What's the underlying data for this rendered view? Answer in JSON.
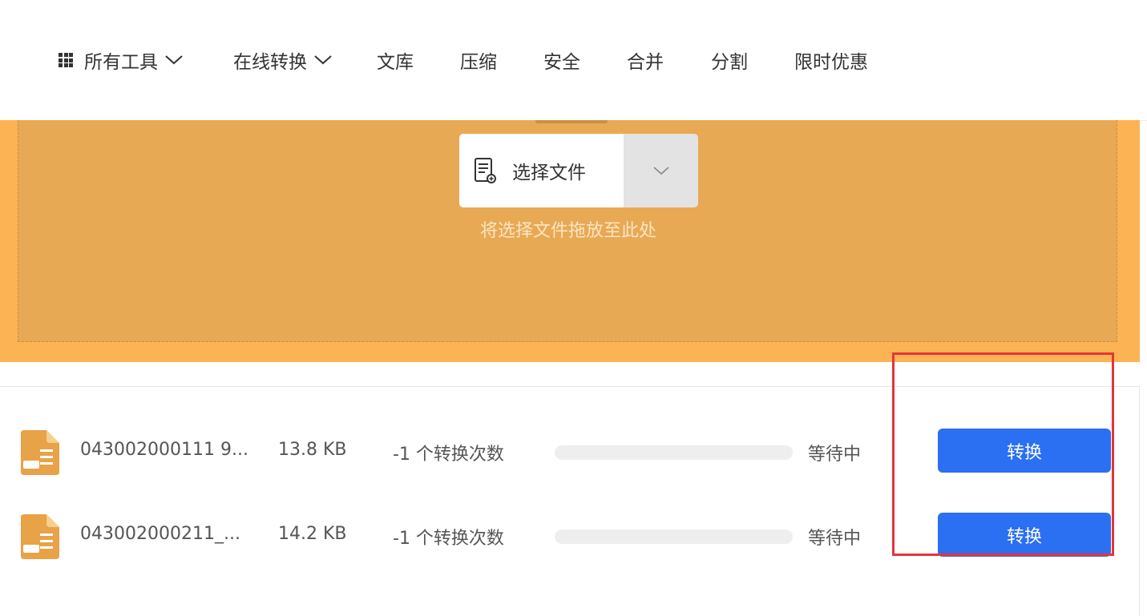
{
  "nav": {
    "items": [
      {
        "label": "所有工具",
        "has_dropdown": true,
        "icon": "grid-icon"
      },
      {
        "label": "在线转换",
        "has_dropdown": true
      },
      {
        "label": "文库",
        "has_dropdown": false
      },
      {
        "label": "压缩",
        "has_dropdown": false
      },
      {
        "label": "安全",
        "has_dropdown": false
      },
      {
        "label": "合并",
        "has_dropdown": false
      },
      {
        "label": "分割",
        "has_dropdown": false
      },
      {
        "label": "限时优惠",
        "has_dropdown": false
      }
    ]
  },
  "upload": {
    "select_label": "选择文件",
    "drop_hint": "将选择文件拖放至此处",
    "icons": {
      "file": "document-icon",
      "dropdown": "chevron-down-icon"
    }
  },
  "files": [
    {
      "name": "043002000111 9...",
      "size": "13.8 KB",
      "count": "-1 个转换次数",
      "progress": 0,
      "status": "等待中",
      "action": "转换",
      "icon": "file-icon"
    },
    {
      "name": "043002000211_...",
      "size": "14.2 KB",
      "count": "-1 个转换次数",
      "progress": 0,
      "status": "等待中",
      "action": "转换",
      "icon": "file-icon"
    }
  ],
  "colors": {
    "accent": "#2b6ff2",
    "upload_bg": "#e8a955",
    "upload_border": "#fcb354",
    "highlight": "#e5343b",
    "file_icon": "#e8a247"
  }
}
